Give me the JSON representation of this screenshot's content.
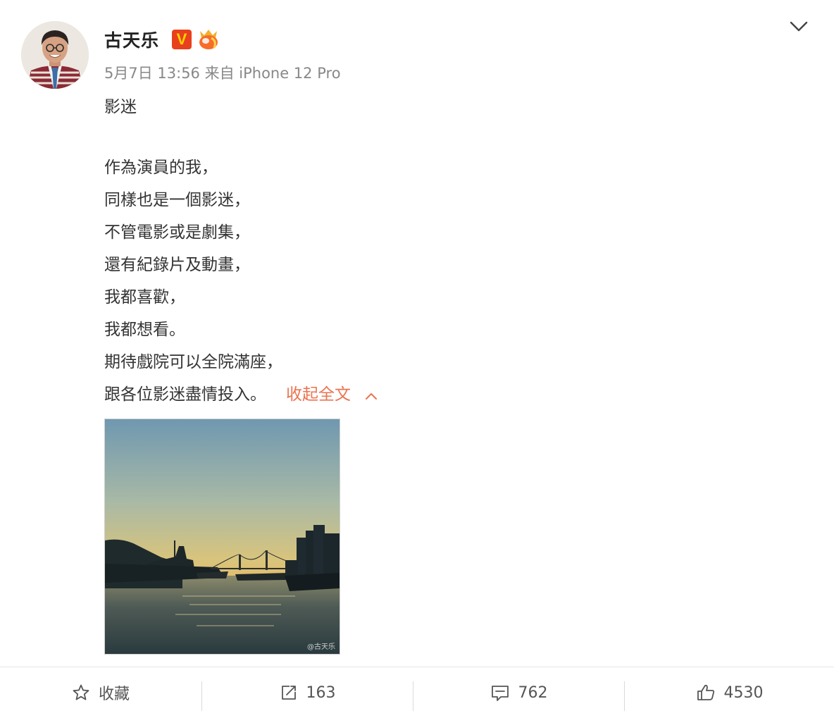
{
  "post": {
    "author": "古天乐",
    "verified_badge": "V",
    "meta": "5月7日 13:56 来自 iPhone 12 Pro",
    "title": "影迷",
    "lines": [
      "作為演員的我，",
      "同樣也是一個影迷，",
      "不管電影或是劇集，",
      "還有紀錄片及動畫，",
      "我都喜歡，",
      "我都想看。",
      "期待戲院可以全院滿座，",
      "跟各位影迷盡情投入。"
    ],
    "collapse_label": "收起全文",
    "image_watermark": "@古天乐",
    "accent_color": "#eb7350"
  },
  "actions": {
    "favorite_label": "收藏",
    "repost_count": "163",
    "comment_count": "762",
    "like_count": "4530"
  },
  "icons": {
    "more": "chevron-down-icon",
    "favorite": "star-icon",
    "repost": "share-icon",
    "comment": "comment-icon",
    "like": "thumbs-up-icon"
  }
}
